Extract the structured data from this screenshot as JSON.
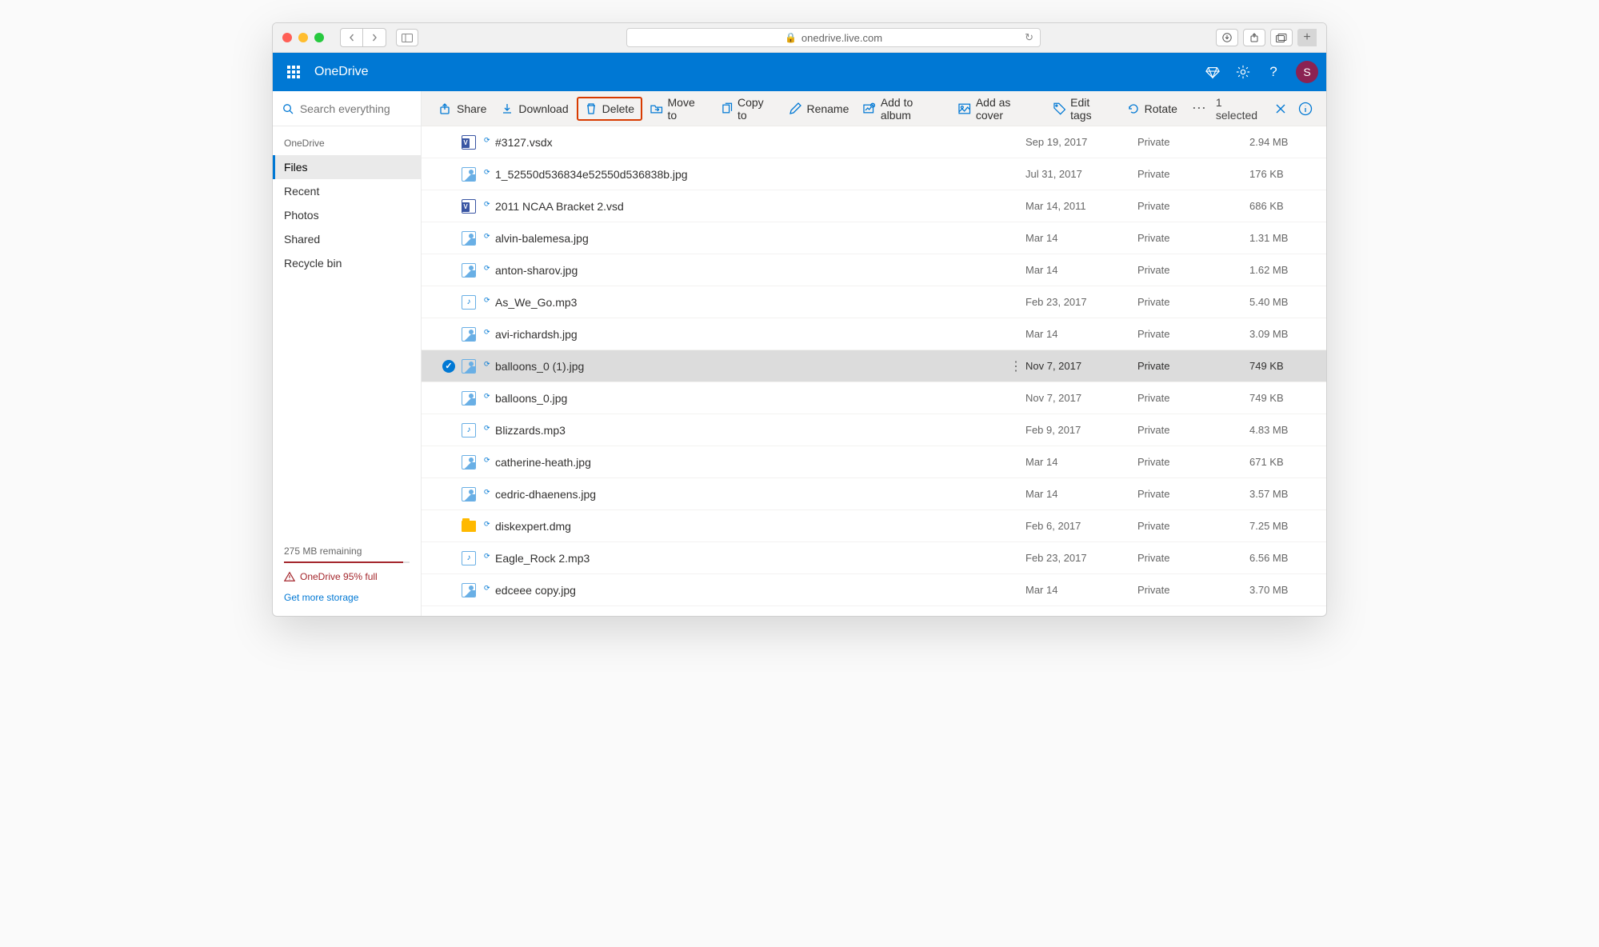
{
  "browser": {
    "url_host": "onedrive.live.com"
  },
  "suitebar": {
    "app_name": "OneDrive",
    "avatar_initial": "S"
  },
  "sidebar": {
    "search_placeholder": "Search everything",
    "heading": "OneDrive",
    "items": [
      {
        "label": "Files",
        "active": true
      },
      {
        "label": "Recent",
        "active": false
      },
      {
        "label": "Photos",
        "active": false
      },
      {
        "label": "Shared",
        "active": false
      },
      {
        "label": "Recycle bin",
        "active": false
      }
    ],
    "remaining": "275 MB remaining",
    "full_warning": "OneDrive 95% full",
    "get_more": "Get more storage"
  },
  "cmdbar": {
    "share": "Share",
    "download": "Download",
    "delete": "Delete",
    "moveto": "Move to",
    "copyto": "Copy to",
    "rename": "Rename",
    "addtoalbum": "Add to album",
    "addascover": "Add as cover",
    "edittags": "Edit tags",
    "rotate": "Rotate",
    "selected_text": "1 selected"
  },
  "files": [
    {
      "icon": "vsd",
      "name": "#3127.vsdx",
      "date": "Sep 19, 2017",
      "share": "Private",
      "size": "2.94 MB",
      "selected": false
    },
    {
      "icon": "img",
      "name": "1_52550d536834e52550d536838b.jpg",
      "date": "Jul 31, 2017",
      "share": "Private",
      "size": "176 KB",
      "selected": false
    },
    {
      "icon": "vsd",
      "name": "2011 NCAA Bracket 2.vsd",
      "date": "Mar 14, 2011",
      "share": "Private",
      "size": "686 KB",
      "selected": false
    },
    {
      "icon": "img",
      "name": "alvin-balemesa.jpg",
      "date": "Mar 14",
      "share": "Private",
      "size": "1.31 MB",
      "selected": false
    },
    {
      "icon": "img",
      "name": "anton-sharov.jpg",
      "date": "Mar 14",
      "share": "Private",
      "size": "1.62 MB",
      "selected": false
    },
    {
      "icon": "mp3",
      "name": "As_We_Go.mp3",
      "date": "Feb 23, 2017",
      "share": "Private",
      "size": "5.40 MB",
      "selected": false
    },
    {
      "icon": "img",
      "name": "avi-richardsh.jpg",
      "date": "Mar 14",
      "share": "Private",
      "size": "3.09 MB",
      "selected": false
    },
    {
      "icon": "img",
      "name": "balloons_0 (1).jpg",
      "date": "Nov 7, 2017",
      "share": "Private",
      "size": "749 KB",
      "selected": true
    },
    {
      "icon": "img",
      "name": "balloons_0.jpg",
      "date": "Nov 7, 2017",
      "share": "Private",
      "size": "749 KB",
      "selected": false
    },
    {
      "icon": "mp3",
      "name": "Blizzards.mp3",
      "date": "Feb 9, 2017",
      "share": "Private",
      "size": "4.83 MB",
      "selected": false
    },
    {
      "icon": "img",
      "name": "catherine-heath.jpg",
      "date": "Mar 14",
      "share": "Private",
      "size": "671 KB",
      "selected": false
    },
    {
      "icon": "img",
      "name": "cedric-dhaenens.jpg",
      "date": "Mar 14",
      "share": "Private",
      "size": "3.57 MB",
      "selected": false
    },
    {
      "icon": "dmg",
      "name": "diskexpert.dmg",
      "date": "Feb 6, 2017",
      "share": "Private",
      "size": "7.25 MB",
      "selected": false
    },
    {
      "icon": "mp3",
      "name": "Eagle_Rock 2.mp3",
      "date": "Feb 23, 2017",
      "share": "Private",
      "size": "6.56 MB",
      "selected": false
    },
    {
      "icon": "img",
      "name": "edceee copy.jpg",
      "date": "Mar 14",
      "share": "Private",
      "size": "3.70 MB",
      "selected": false
    }
  ]
}
